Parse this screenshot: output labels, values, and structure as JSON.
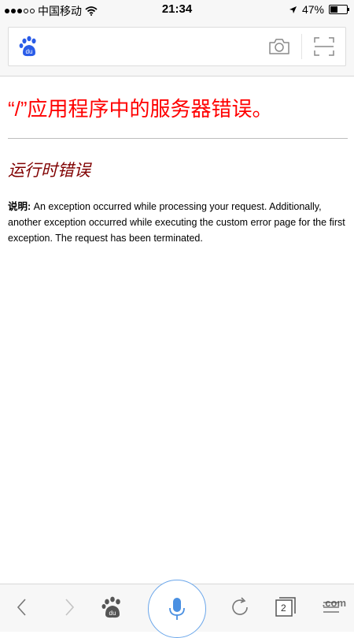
{
  "status_bar": {
    "carrier": "中国移动",
    "time": "21:34",
    "battery": "47%",
    "battery_level": 0.47
  },
  "header": {
    "logo_text": "du"
  },
  "page": {
    "error_title": "“/”应用程序中的服务器错误。",
    "runtime_error": "运行时错误",
    "description_label": "说明:",
    "description_text": " An exception occurred while processing your request. Additionally, another exception occurred while executing the custom error page for the first exception. The request has been terminated."
  },
  "toolbar": {
    "logo_text": "du",
    "tab_count": "2",
    "watermark": ".com"
  },
  "colors": {
    "error_red": "#ff0000",
    "runtime_maroon": "#800000",
    "baidu_blue": "#2a5ce8",
    "mic_blue": "#4a90e2"
  }
}
